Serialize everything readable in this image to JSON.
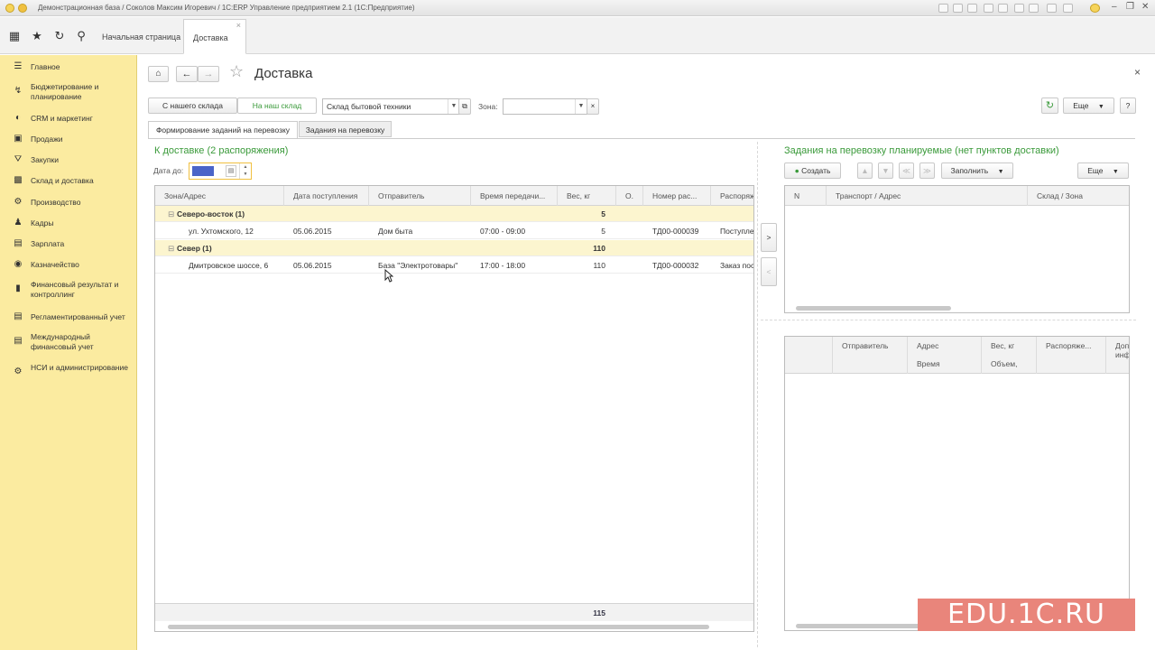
{
  "window": {
    "title": "Демонстрационная база / Соколов Максим Игоревич / 1С:ERP Управление предприятием 2.1  (1С:Предприятие)"
  },
  "tabs": [
    {
      "label": "Начальная страница"
    },
    {
      "label": "Доставка",
      "close": "×"
    }
  ],
  "sidebar": {
    "items": [
      {
        "label": "Главное",
        "icon": "menu-icon"
      },
      {
        "label": "Бюджетирование и планирование",
        "icon": "budget-icon"
      },
      {
        "label": "CRM и маркетинг",
        "icon": "crm-icon"
      },
      {
        "label": "Продажи",
        "icon": "sales-icon"
      },
      {
        "label": "Закупки",
        "icon": "cart-icon"
      },
      {
        "label": "Склад и доставка",
        "icon": "warehouse-icon"
      },
      {
        "label": "Производство",
        "icon": "factory-icon"
      },
      {
        "label": "Кадры",
        "icon": "people-icon"
      },
      {
        "label": "Зарплата",
        "icon": "salary-icon"
      },
      {
        "label": "Казначейство",
        "icon": "treasury-icon"
      },
      {
        "label": "Финансовый результат и контроллинг",
        "icon": "chart-icon"
      },
      {
        "label": "Регламентированный учет",
        "icon": "ledger-icon"
      },
      {
        "label": "Международный финансовый учет",
        "icon": "globe-icon"
      },
      {
        "label": "НСИ и администрирование",
        "icon": "gear-icon"
      }
    ]
  },
  "page": {
    "title": "Доставка",
    "close": "×"
  },
  "toolbar": {
    "from_our_warehouse": "С нашего склада",
    "to_our_warehouse": "На наш склад",
    "warehouse_value": "Склад бытовой техники",
    "zone_label": "Зона:",
    "zone_value": "",
    "more": "Еще",
    "help": "?"
  },
  "subtabs": [
    {
      "label": "Формирование заданий на перевозку"
    },
    {
      "label": "Задания на перевозку"
    }
  ],
  "left": {
    "title": "К доставке (2 распоряжения)",
    "date_label": "Дата до:",
    "columns": [
      "Зона/Адрес",
      "Дата поступления",
      "Отправитель",
      "Время передачи...",
      "Вес, кг",
      "О.",
      "Номер рас...",
      "Распоряж"
    ],
    "rows": [
      {
        "type": "group",
        "cells": [
          "Северо-восток (1)",
          "",
          "",
          "",
          "5",
          "",
          "",
          ""
        ]
      },
      {
        "type": "item",
        "cells": [
          "ул. Ухтомского, 12",
          "05.06.2015",
          "Дом быта",
          "07:00 - 09:00",
          "5",
          "",
          "ТД00-000039",
          "Поступле"
        ]
      },
      {
        "type": "group",
        "cells": [
          "Север (1)",
          "",
          "",
          "",
          "110",
          "",
          "",
          ""
        ]
      },
      {
        "type": "item",
        "cells": [
          "Дмитровское шоссе, 6",
          "05.06.2015",
          "База \"Электротовары\"",
          "17:00 - 18:00",
          "110",
          "",
          "ТД00-000032",
          "Заказ пос"
        ]
      }
    ],
    "total_weight": "115"
  },
  "transfer": {
    "right": ">",
    "left": "<"
  },
  "right": {
    "title": "Задания на перевозку планируемые (нет пунктов доставки)",
    "create": "Создать",
    "fill": "Заполнить",
    "more": "Еще",
    "columns": [
      "N",
      "Транспорт / Адрес",
      "Склад / Зона"
    ],
    "lower_columns_top": [
      "Отправитель",
      "Адрес",
      "Вес, кг",
      "Распоряже...",
      "Доп"
    ],
    "lower_columns_bottom": [
      "Время",
      "Объем,",
      "инф"
    ]
  },
  "watermark": "EDU.1C.RU"
}
